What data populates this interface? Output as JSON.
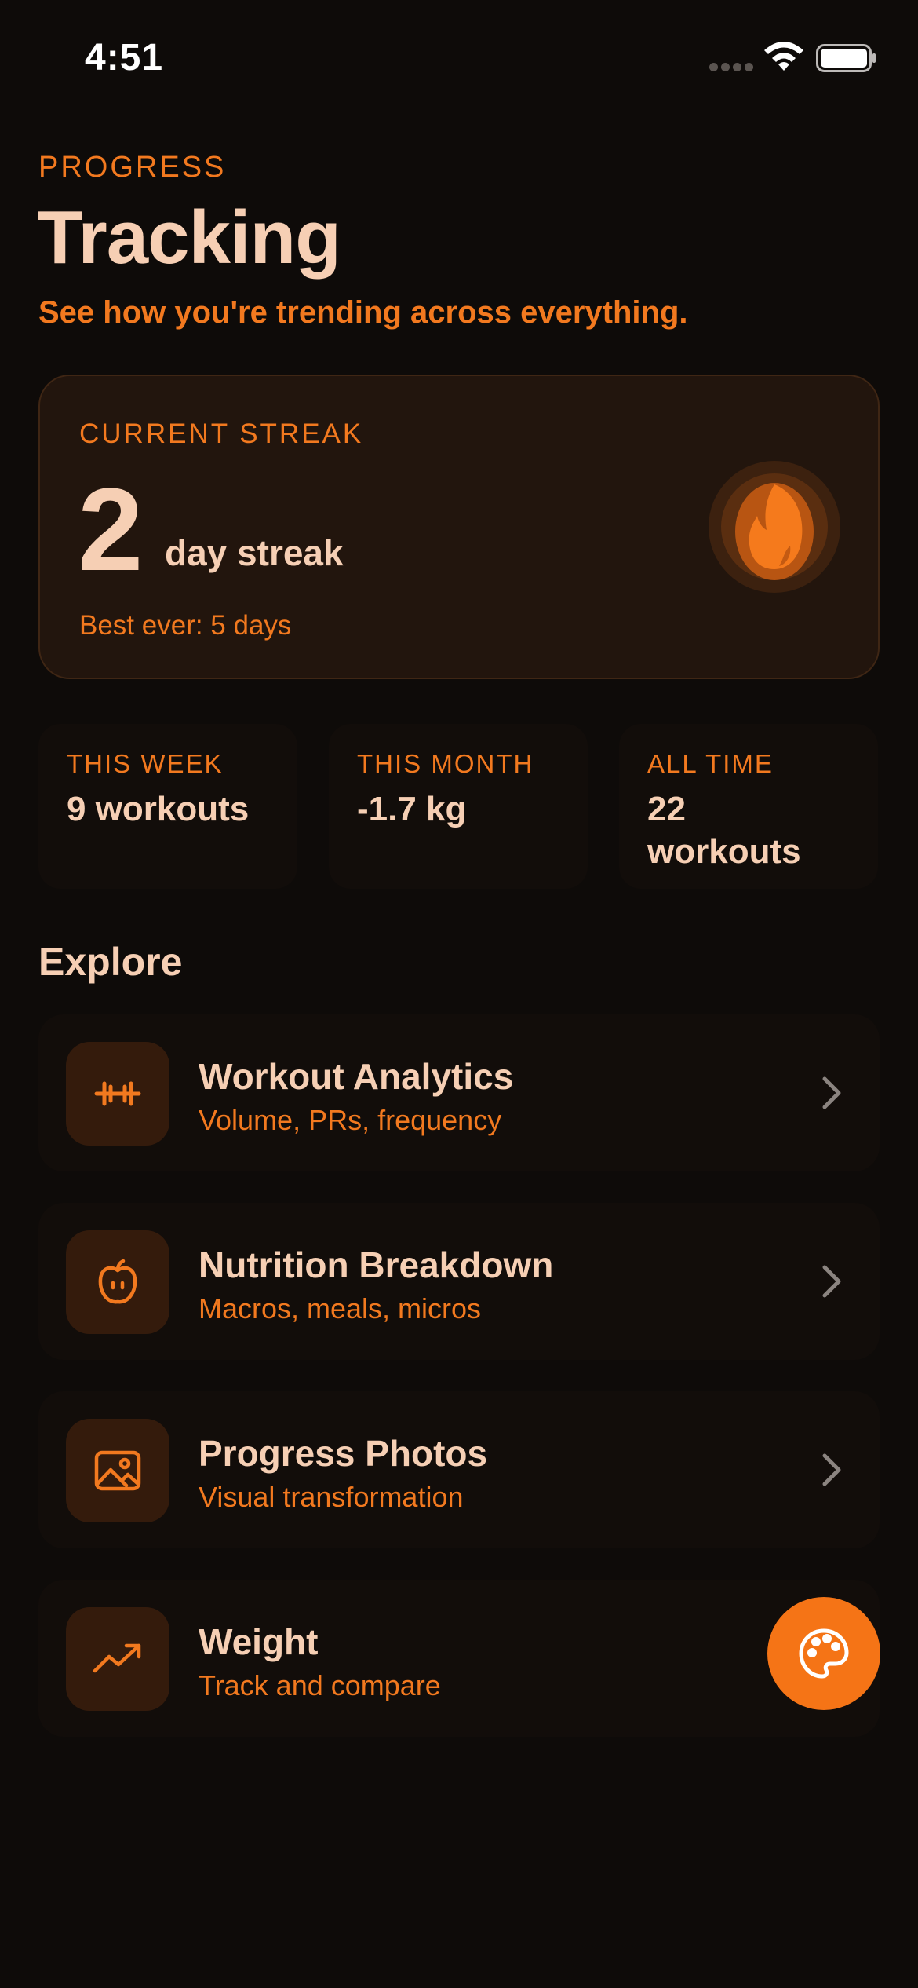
{
  "status_bar": {
    "time": "4:51",
    "icons": [
      "signal-dots-icon",
      "wifi-icon",
      "battery-icon"
    ]
  },
  "header": {
    "eyebrow": "PROGRESS",
    "title": "Tracking",
    "subtitle": "See how you're trending across everything."
  },
  "streak": {
    "label": "CURRENT STREAK",
    "count": "2",
    "unit": "day streak",
    "best": "Best ever: 5 days",
    "icon": "flame-icon"
  },
  "stats": [
    {
      "label": "THIS WEEK",
      "value": "9 workouts"
    },
    {
      "label": "THIS MONTH",
      "value": "-1.7 kg"
    },
    {
      "label": "ALL TIME",
      "value": "22 workouts"
    }
  ],
  "explore": {
    "title": "Explore",
    "items": [
      {
        "title": "Workout Analytics",
        "subtitle": "Volume, PRs, frequency",
        "icon": "dumbbell-icon"
      },
      {
        "title": "Nutrition Breakdown",
        "subtitle": "Macros, meals, micros",
        "icon": "apple-icon"
      },
      {
        "title": "Progress Photos",
        "subtitle": "Visual transformation",
        "icon": "image-icon"
      },
      {
        "title": "Weight",
        "subtitle": "Track and compare",
        "icon": "trending-up-icon"
      }
    ]
  },
  "fab": {
    "icon": "palette-icon"
  },
  "colors": {
    "background": "#0e0b09",
    "accent": "#f2791f",
    "text_primary": "#f6cfb4",
    "card": "#22150d",
    "tile": "#120d0a",
    "icon_box": "#341b0c",
    "fab": "#f57416"
  }
}
